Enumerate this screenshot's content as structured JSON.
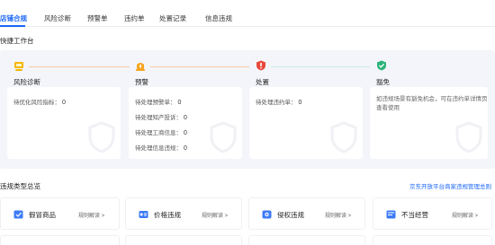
{
  "tabs": [
    {
      "label": "店铺合规",
      "active": true
    },
    {
      "label": "风险诊断",
      "active": false
    },
    {
      "label": "预警单",
      "active": false
    },
    {
      "label": "违约单",
      "active": false
    },
    {
      "label": "处置记录",
      "active": false
    },
    {
      "label": "信息违规",
      "active": false
    }
  ],
  "workbench": {
    "title": "快捷工作台",
    "stages": [
      {
        "title": "风险诊断",
        "icon": "risk-diagnosis-icon",
        "color": "#f5b700",
        "rows": [
          {
            "label": "待优化风险指标：",
            "value": "0"
          }
        ]
      },
      {
        "title": "预警",
        "icon": "warning-icon",
        "color": "#f5a623",
        "rows": [
          {
            "label": "待处理预警单：",
            "value": "0"
          },
          {
            "label": "待处理知产投诉：",
            "value": "0"
          },
          {
            "label": "待处理工商信息：",
            "value": "0"
          },
          {
            "label": "待处理信息违规：",
            "value": "0"
          }
        ]
      },
      {
        "title": "处置",
        "icon": "disposal-shield-icon",
        "color": "#e8473b",
        "rows": [
          {
            "label": "待处理违约单：",
            "value": "0"
          }
        ]
      },
      {
        "title": "豁免",
        "icon": "exemption-shield-icon",
        "color": "#2db37a",
        "desc": "如违规场景有豁免机会，可在违约单详情页查看使用"
      }
    ]
  },
  "violations": {
    "title": "违规类型总览",
    "link": "京东开放平台商家违规管理总则",
    "rule_label": "规则解读 >",
    "items": [
      {
        "name": "假冒商品",
        "icon": "counterfeit-icon"
      },
      {
        "name": "价格违规",
        "icon": "price-violation-icon"
      },
      {
        "name": "侵权违规",
        "icon": "infringement-icon"
      },
      {
        "name": "不当经营",
        "icon": "improper-operation-icon"
      }
    ]
  },
  "colors": {
    "accent": "#1a66f5",
    "panel_bg": "#f3f5fa"
  }
}
